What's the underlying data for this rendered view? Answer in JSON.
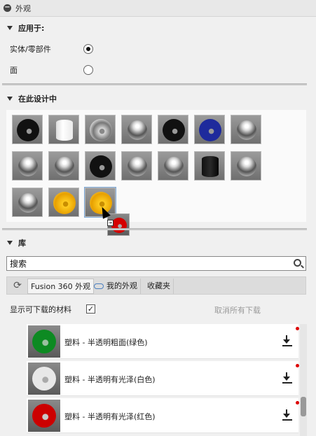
{
  "panel": {
    "title": "外观",
    "collapse_icon": "minus-circle-icon"
  },
  "apply_to": {
    "heading": "应用于:",
    "options": [
      {
        "label": "实体/零部件",
        "selected": true
      },
      {
        "label": "面",
        "selected": false
      }
    ]
  },
  "in_design": {
    "heading": "在此设计中",
    "swatches": [
      "black-glossy-ring",
      "white-cylinder",
      "glass-ring",
      "chrome-sphere",
      "black-ring",
      "blue-ring",
      "chrome-sphere",
      "chrome-sphere",
      "chrome-sphere",
      "black-ring",
      "chrome-sphere",
      "chrome-sphere",
      "black-cylinder",
      "chrome-sphere",
      "chrome-sphere",
      "gold-ring",
      "gold-ring"
    ],
    "drag_preview": "red-ring"
  },
  "library": {
    "heading": "库",
    "search_value": "搜索",
    "search_icon": "search-icon",
    "refresh_icon": "refresh-icon",
    "tabs": [
      {
        "label": "Fusion 360 外观",
        "active": true
      },
      {
        "label": "我的外观",
        "icon": "cloud-icon",
        "active": false
      },
      {
        "label": "收藏夹",
        "active": false
      }
    ],
    "show_downloadable_label": "显示可下载的材料",
    "show_downloadable_checked": true,
    "cancel_all_downloads": "取消所有下载",
    "materials": [
      {
        "name": "塑料 - 半透明粗面(绿色)",
        "color": "#0d8a22"
      },
      {
        "name": "塑料 - 半透明有光泽(白色)",
        "color": "#e8e8e8"
      },
      {
        "name": "塑料 - 半透明有光泽(红色)",
        "color": "#cc0000"
      }
    ]
  }
}
